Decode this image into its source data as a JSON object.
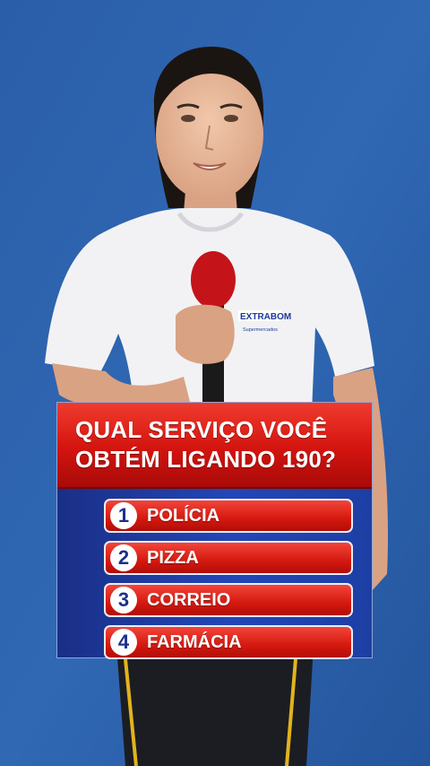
{
  "video": {
    "shirt_logo": "EXTRABOM",
    "shirt_logo_sub": "Supermercados"
  },
  "quiz": {
    "question_line1": "QUAL SERVIÇO VOCÊ",
    "question_line2": "OBTÉM LIGANDO 190?",
    "options": [
      {
        "number": "1",
        "label": "POLÍCIA"
      },
      {
        "number": "2",
        "label": "PIZZA"
      },
      {
        "number": "3",
        "label": "CORREIO"
      },
      {
        "number": "4",
        "label": "FARMÁCIA"
      }
    ]
  },
  "colors": {
    "background": "#2c5fa8",
    "question_red": "#d3140f",
    "panel_blue": "#1d3fa4",
    "number_text": "#1c2f8c"
  }
}
